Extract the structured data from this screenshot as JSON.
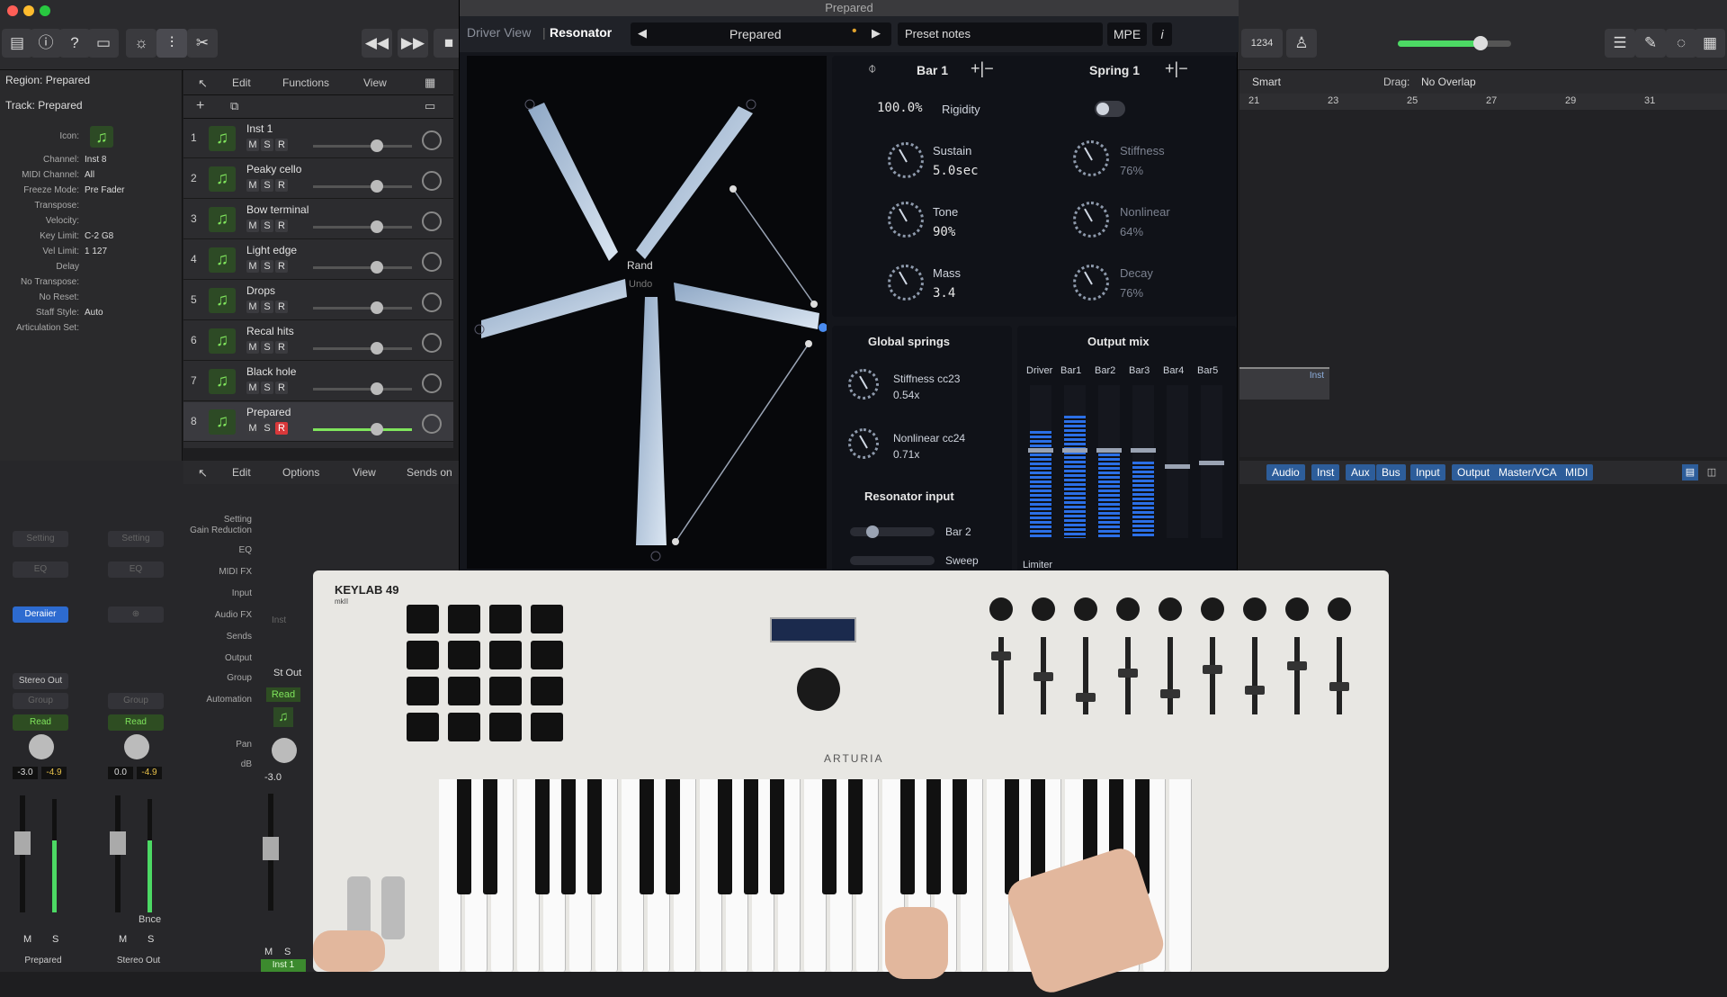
{
  "toolbar": {
    "lcd": "1234",
    "plugin_window_title": "Prepared"
  },
  "inspector": {
    "region": "Region: Prepared",
    "track": "Track: Prepared",
    "rows": [
      {
        "k": "Icon:",
        "v": ""
      },
      {
        "k": "Channel:",
        "v": "Inst 8"
      },
      {
        "k": "MIDI Channel:",
        "v": "All"
      },
      {
        "k": "Freeze Mode:",
        "v": "Pre Fader"
      },
      {
        "k": "Transpose:",
        "v": ""
      },
      {
        "k": "Velocity:",
        "v": ""
      },
      {
        "k": "Key Limit:",
        "v": "C-2  G8"
      },
      {
        "k": "Vel Limit:",
        "v": "1  127"
      },
      {
        "k": "Delay",
        "v": ""
      },
      {
        "k": "No Transpose:",
        "v": ""
      },
      {
        "k": "No Reset:",
        "v": ""
      },
      {
        "k": "Staff Style:",
        "v": "Auto"
      },
      {
        "k": "Articulation Set:",
        "v": ""
      }
    ]
  },
  "track_menu": {
    "edit": "Edit",
    "functions": "Functions",
    "view": "View"
  },
  "tracks": [
    {
      "num": "1",
      "name": "Inst 1",
      "record_armed": false
    },
    {
      "num": "2",
      "name": "Peaky cello",
      "record_armed": false
    },
    {
      "num": "3",
      "name": "Bow terminal",
      "record_armed": false
    },
    {
      "num": "4",
      "name": "Light edge",
      "record_armed": false
    },
    {
      "num": "5",
      "name": "Drops",
      "record_armed": false
    },
    {
      "num": "6",
      "name": "Recal hits",
      "record_armed": false
    },
    {
      "num": "7",
      "name": "Black hole",
      "record_armed": false
    },
    {
      "num": "8",
      "name": "Prepared",
      "record_armed": true
    }
  ],
  "msr": {
    "m": "M",
    "s": "S",
    "r": "R"
  },
  "plugin": {
    "tab_driver": "Driver View",
    "tab_resonator": "Resonator",
    "preset": "Prepared",
    "preset_notes": "Preset notes",
    "mpe": "MPE",
    "info": "i",
    "rand": "Rand",
    "undo": "Undo",
    "bar_label": "Bar 1",
    "spring_label": "Spring 1",
    "plus_minus": "+|−",
    "rigidity_value": "100.0%",
    "rigidity": "Rigidity",
    "sustain": "Sustain",
    "sustain_value": "5.0sec",
    "stiffness": "Stiffness",
    "stiffness_value": "76%",
    "tone": "Tone",
    "tone_value": "90%",
    "nonlinear": "Nonlinear",
    "nonlinear_value": "64%",
    "mass": "Mass",
    "mass_value": "3.4",
    "decay": "Decay",
    "decay_value": "76%",
    "global_springs": "Global springs",
    "gs_stiffness": "Stiffness cc23",
    "gs_stiffness_value": "0.54x",
    "gs_nonlinear": "Nonlinear cc24",
    "gs_nonlinear_value": "0.71x",
    "resonator_input": "Resonator input",
    "ri_bar": "Bar 2",
    "ri_sweep": "Sweep",
    "output_mix": "Output mix",
    "mix_columns": [
      "Driver",
      "Bar1",
      "Bar2",
      "Bar3",
      "Bar4",
      "Bar5"
    ],
    "mix_levels": [
      0.7,
      0.8,
      0.55,
      0.5,
      0.0,
      0.0
    ],
    "limiter": "Limiter"
  },
  "arrange": {
    "smart": "Smart",
    "drag": "Drag:",
    "drag_mode": "No Overlap",
    "ruler": [
      "21",
      "23",
      "25",
      "27",
      "29",
      "31"
    ],
    "region_label": "Inst"
  },
  "mixer_tabs": [
    "Audio",
    "Inst",
    "Aux",
    "Bus",
    "Input",
    "Output",
    "Master/VCA",
    "MIDI"
  ],
  "mixer_menu": {
    "edit": "Edit",
    "options": "Options",
    "view": "View",
    "sends": "Sends on"
  },
  "mixer_labels": [
    "Setting",
    "Gain Reduction",
    "EQ",
    "MIDI FX",
    "Input",
    "Audio FX",
    "Sends",
    "Output",
    "Group",
    "Automation",
    "Pan",
    "dB"
  ],
  "channel": {
    "output": "St Out",
    "automation": "Read",
    "db": "-3.0",
    "name": "Inst 1",
    "input": "Inst"
  },
  "strips": [
    {
      "setting": "Setting",
      "eq": "EQ",
      "plugin": "Deraiier",
      "out": "Stereo Out",
      "group": "Group",
      "read": "Read",
      "vol": "-3.0",
      "peak": "-4.9",
      "name": "Prepared"
    },
    {
      "setting": "Setting",
      "eq": "EQ",
      "plugin": "",
      "out": "",
      "group": "Group",
      "read": "Read",
      "vol": "0.0",
      "peak": "-4.9",
      "name": "Stereo Out"
    }
  ],
  "bnce": "Bnce",
  "keyboard": {
    "brand": "ARTURIA",
    "model": "KEYLAB 49",
    "series": "mkII"
  },
  "colors": {
    "accent": "#2d6bd0",
    "track_icon": "#7fe45c",
    "record": "#d9383a"
  }
}
